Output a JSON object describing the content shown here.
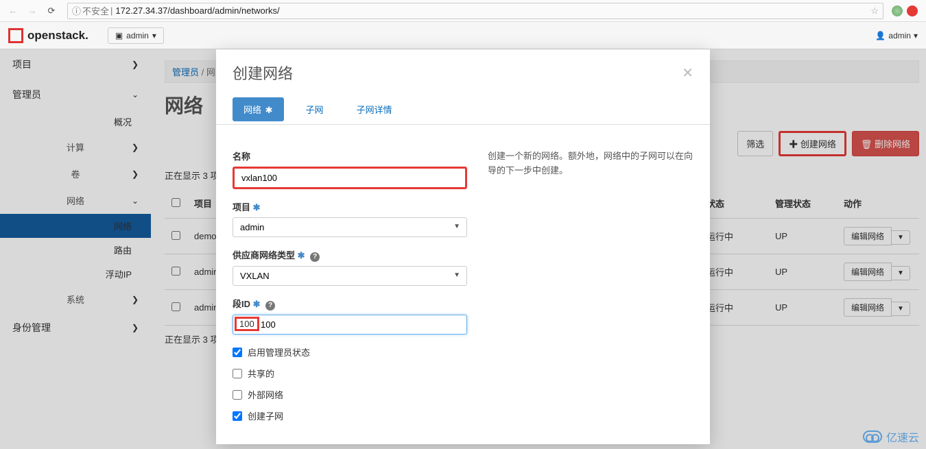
{
  "browser": {
    "insecure_label": "不安全",
    "url": "172.27.34.37/dashboard/admin/networks/"
  },
  "brand": {
    "name": "openstack."
  },
  "top_dropdown": {
    "label": "admin"
  },
  "user_menu": {
    "label": "admin"
  },
  "sidebar": {
    "project": "项目",
    "admin": "管理员",
    "overview": "概况",
    "compute": "计算",
    "volume": "卷",
    "network": "网络",
    "network_sub": "网络",
    "router": "路由",
    "floating_ip": "浮动IP",
    "system": "系统",
    "identity": "身份管理"
  },
  "breadcrumb": {
    "admin": "管理员",
    "net": "网"
  },
  "page_title": "网络",
  "actions": {
    "filter": "筛选",
    "create": "创建网络",
    "delete": "删除网络"
  },
  "showing": "正在显示 3 项",
  "table": {
    "headers": {
      "project": "项目",
      "status": "状态",
      "admin_state": "管理状态",
      "action": "动作"
    },
    "rows": [
      {
        "project": "demo",
        "status": "运行中",
        "admin_state": "UP",
        "action": "编辑网络"
      },
      {
        "project": "admin",
        "status": "运行中",
        "admin_state": "UP",
        "action": "编辑网络"
      },
      {
        "project": "admin",
        "status": "运行中",
        "admin_state": "UP",
        "action": "编辑网络"
      }
    ]
  },
  "modal": {
    "title": "创建网络",
    "tabs": {
      "network": "网络",
      "subnet": "子网",
      "subnet_detail": "子网详情"
    },
    "form": {
      "name_label": "名称",
      "name_value": "vxlan100",
      "project_label": "项目",
      "project_value": "admin",
      "provider_label": "供应商网络类型",
      "provider_value": "VXLAN",
      "segment_label": "段ID",
      "segment_value": "100",
      "enable_admin": "启用管理员状态",
      "shared": "共享的",
      "external": "外部网络",
      "create_subnet": "创建子网"
    },
    "help": "创建一个新的网络。额外地，网络中的子网可以在向导的下一步中创建。"
  },
  "watermark": "亿速云"
}
